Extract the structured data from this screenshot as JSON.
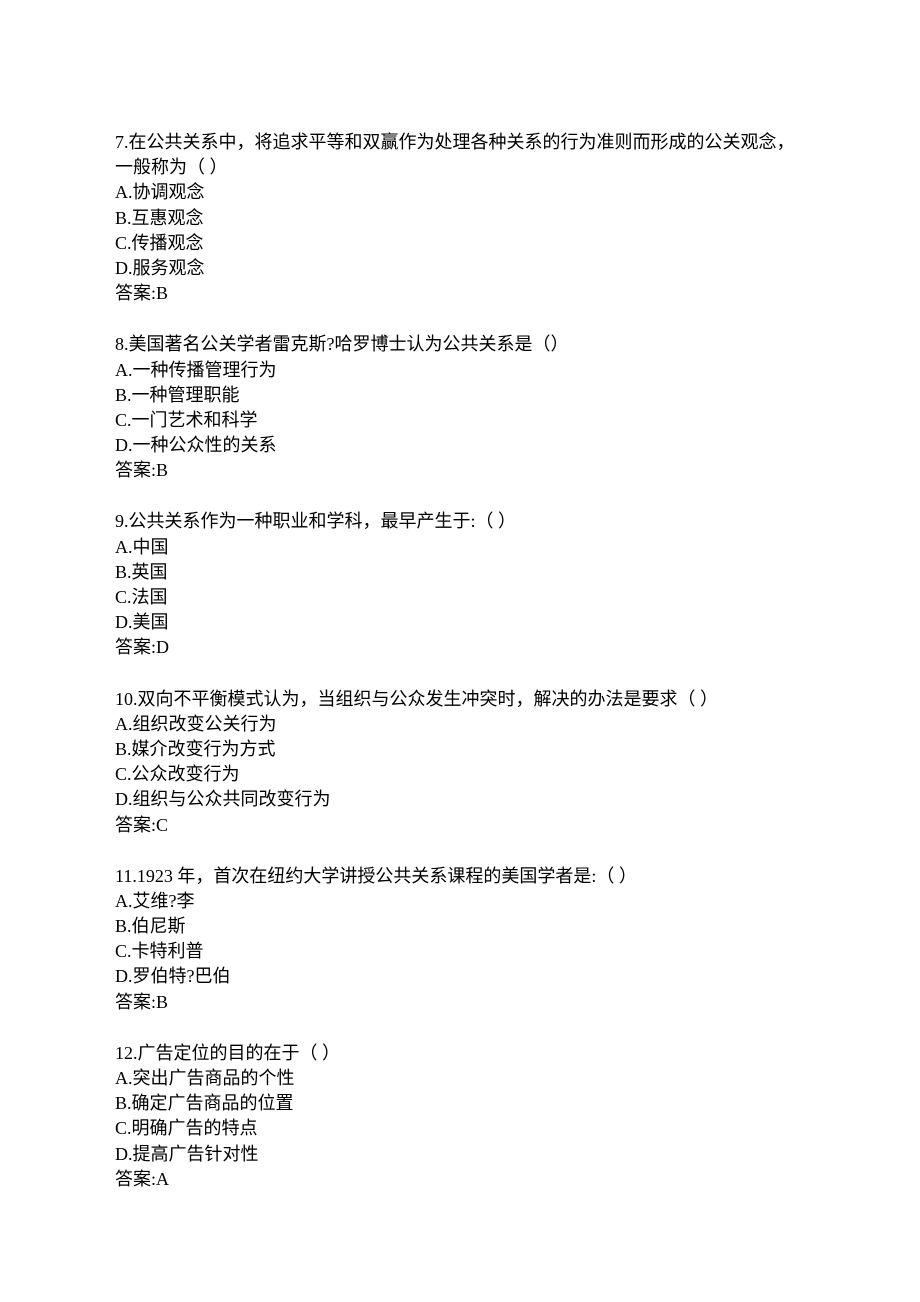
{
  "questions": [
    {
      "number": "7",
      "text": "在公共关系中，将追求平等和双赢作为处理各种关系的行为准则而形成的公关观念，一般称为（ ）",
      "options": {
        "A": "协调观念",
        "B": "互惠观念",
        "C": "传播观念",
        "D": "服务观念"
      },
      "answer": "B"
    },
    {
      "number": "8",
      "text": "美国著名公关学者雷克斯?哈罗博士认为公共关系是（）",
      "options": {
        "A": "一种传播管理行为",
        "B": "一种管理职能",
        "C": "一门艺术和科学",
        "D": "一种公众性的关系"
      },
      "answer": "B"
    },
    {
      "number": "9",
      "text": "公共关系作为一种职业和学科，最早产生于:（ ）",
      "options": {
        "A": "中国",
        "B": "英国",
        "C": "法国",
        "D": "美国"
      },
      "answer": "D"
    },
    {
      "number": "10",
      "text": "双向不平衡模式认为，当组织与公众发生冲突时，解决的办法是要求（ ）",
      "options": {
        "A": "组织改变公关行为",
        "B": "媒介改变行为方式",
        "C": "公众改变行为",
        "D": "组织与公众共同改变行为"
      },
      "answer": "C"
    },
    {
      "number": "11",
      "text": "1923 年，首次在纽约大学讲授公共关系课程的美国学者是:（ ）",
      "options": {
        "A": "艾维?李",
        "B": "伯尼斯",
        "C": "卡特利普",
        "D": "罗伯特?巴伯"
      },
      "answer": "B"
    },
    {
      "number": "12",
      "text": "广告定位的目的在于（ ）",
      "options": {
        "A": "突出广告商品的个性",
        "B": "确定广告商品的位置",
        "C": "明确广告的特点",
        "D": "提高广告针对性"
      },
      "answer": "A"
    }
  ],
  "answerLabel": "答案:"
}
